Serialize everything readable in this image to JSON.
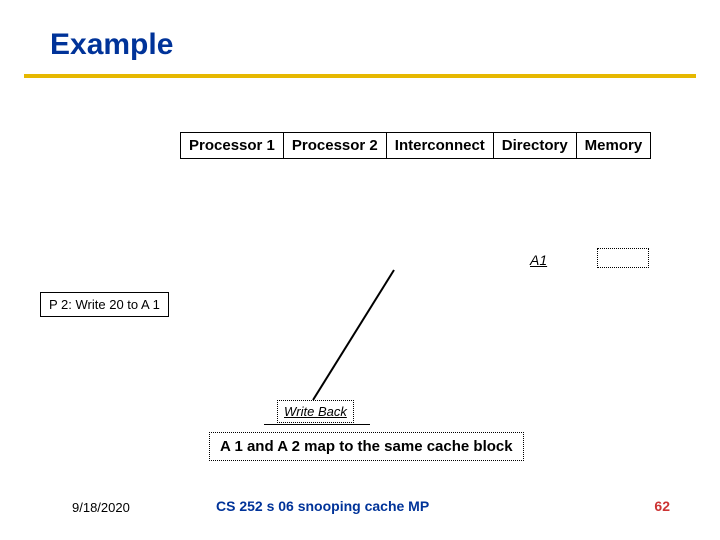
{
  "title": "Example",
  "headers": {
    "p1": "Processor 1",
    "p2": "Processor 2",
    "ic": "Interconnect",
    "dir": "Directory",
    "mem": "Memory"
  },
  "dir_entry": "A1",
  "p2_action": "P 2: Write 20 to A 1",
  "writeback": "Write Back",
  "map_note": "A 1 and A 2 map to the same cache block",
  "footer": {
    "date": "9/18/2020",
    "course": "CS 252 s 06 snooping cache MP",
    "page": "62"
  }
}
